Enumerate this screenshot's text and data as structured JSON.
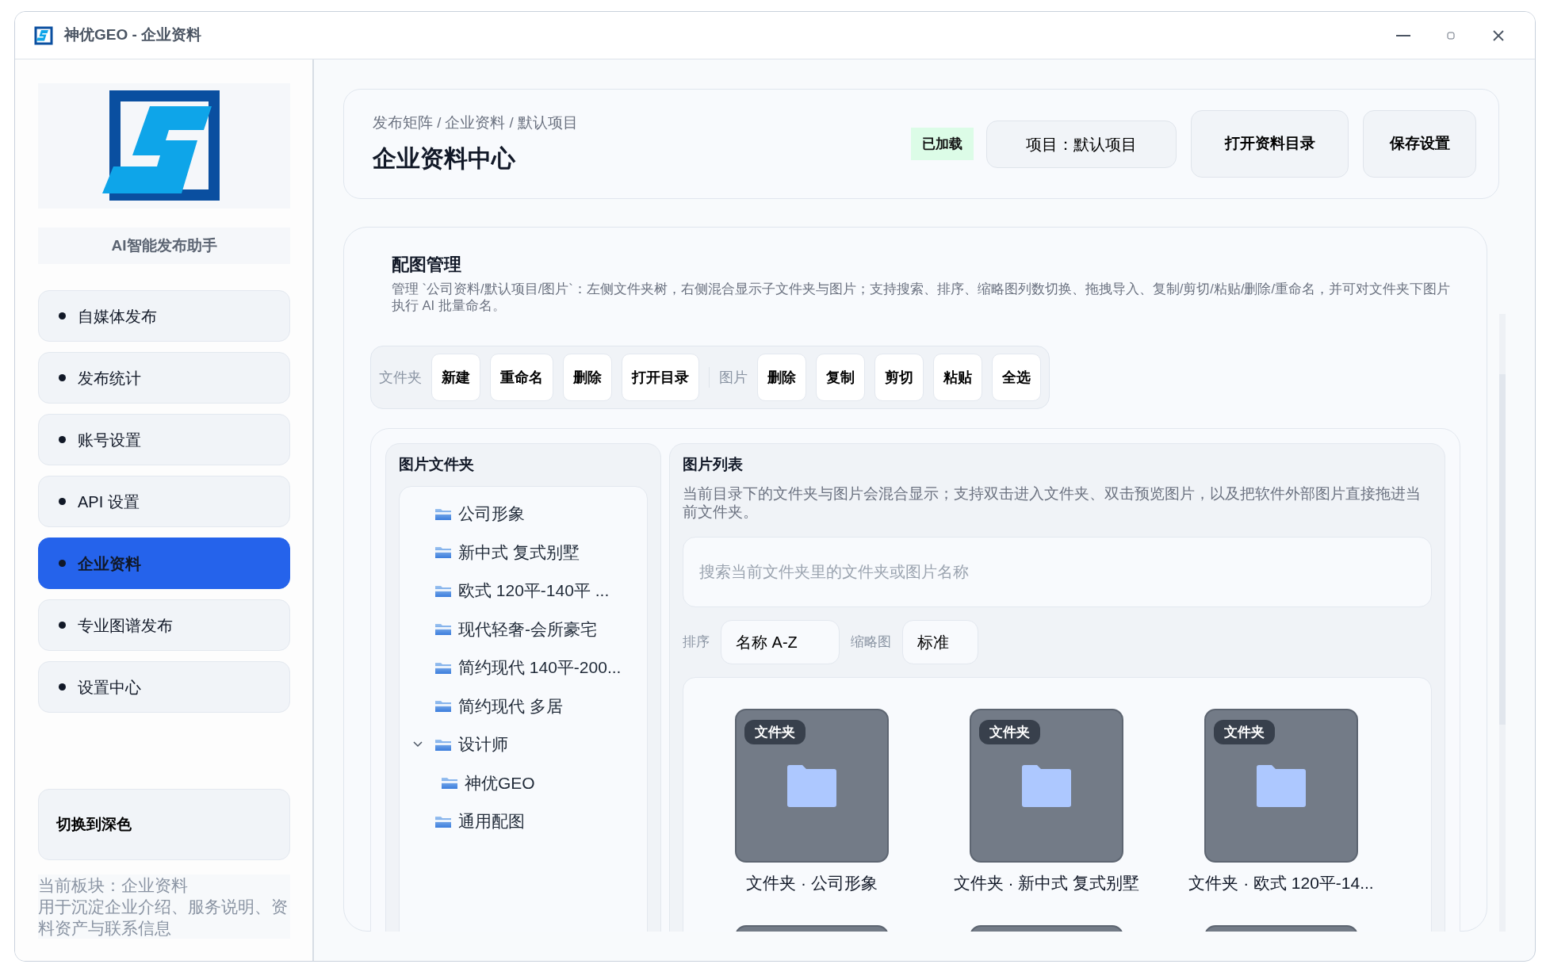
{
  "window": {
    "title": "神优GEO - 企业资料"
  },
  "sidebar": {
    "brand_caption": "AI智能发布助手",
    "nav": [
      {
        "label": "自媒体发布",
        "selected": false
      },
      {
        "label": "发布统计",
        "selected": false
      },
      {
        "label": "账号设置",
        "selected": false
      },
      {
        "label": "API 设置",
        "selected": false
      },
      {
        "label": "企业资料",
        "selected": true
      },
      {
        "label": "专业图谱发布",
        "selected": false
      },
      {
        "label": "设置中心",
        "selected": false
      }
    ],
    "theme_button": "切换到深色",
    "footer": [
      "当前板块：企业资料",
      "用于沉淀企业介绍、服务说明、资料资产与联系信息"
    ]
  },
  "header": {
    "breadcrumb": "发布矩阵 / 企业资料 / 默认项目",
    "title": "企业资料中心",
    "status_badge": "已加载",
    "project_button": "项目：默认项目",
    "buttons": [
      "打开资料目录",
      "保存设置"
    ]
  },
  "gallery_manager": {
    "title": "配图管理",
    "description": "管理 `公司资料/默认项目/图片`：左侧文件夹树，右侧混合显示子文件夹与图片；支持搜索、排序、缩略图列数切换、拖拽导入、复制/剪切/粘贴/删除/重命名，并可对文件夹下图片执行 AI 批量命名。",
    "toolbar_groups": [
      {
        "label": "文件夹",
        "buttons": [
          "新建",
          "重命名",
          "删除",
          "打开目录"
        ]
      },
      {
        "label": "图片",
        "buttons": [
          "删除",
          "复制",
          "剪切",
          "粘贴",
          "全选"
        ]
      }
    ],
    "folder_panel": {
      "title": "图片文件夹",
      "tree": [
        {
          "label": "公司形象"
        },
        {
          "label": "新中式 复式别墅"
        },
        {
          "label": "欧式 120平-140平 ..."
        },
        {
          "label": "现代轻奢-会所豪宅"
        },
        {
          "label": "简约现代 140平-200..."
        },
        {
          "label": "简约现代 多居"
        },
        {
          "label": "设计师",
          "expanded": true,
          "children": [
            {
              "label": "神优GEO"
            }
          ]
        },
        {
          "label": "通用配图"
        }
      ]
    },
    "image_list": {
      "title": "图片列表",
      "description": "当前目录下的文件夹与图片会混合显示；支持双击进入文件夹、双击预览图片，以及把软件外部图片直接拖进当前文件夹。",
      "search": {
        "placeholder": "搜索当前文件夹里的文件夹或图片名称"
      },
      "sort": {
        "label": "排序",
        "value": "名称 A-Z"
      },
      "thumb_size": {
        "label": "缩略图",
        "value": "标准"
      },
      "items": [
        {
          "kind": "folder",
          "badge": "文件夹",
          "caption": "文件夹 · 公司形象"
        },
        {
          "kind": "folder",
          "badge": "文件夹",
          "caption": "文件夹 · 新中式 复式别墅"
        },
        {
          "kind": "folder",
          "badge": "文件夹",
          "caption": "文件夹 · 欧式 120平-14..."
        },
        {
          "kind": "cut-off"
        },
        {
          "kind": "cut-off"
        },
        {
          "kind": "cut-off"
        }
      ]
    }
  }
}
